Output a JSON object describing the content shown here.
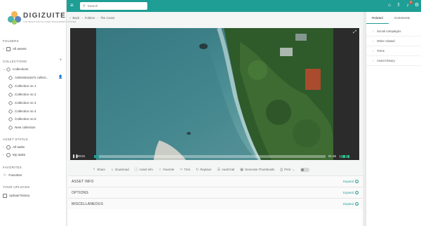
{
  "brand": {
    "name": "DIGIZUITE",
    "tagline": "THE SMART DIGITAL ASSET MANAGEMENT SYSTEM"
  },
  "sidebar": {
    "folders_title": "FOLDERS",
    "all_assets": "All assets",
    "collections_title": "COLLECTIONS",
    "collections_root": "Collections",
    "collections": [
      "Administrator's collect...",
      "Collection no 1",
      "Collection no 2",
      "Collection no 3",
      "Collection no 4",
      "Collection no 5",
      "New collection"
    ],
    "asset_status_title": "ASSET STATUS",
    "all_tasks": "All tasks",
    "my_tasks": "My tasks",
    "favorites_title": "FAVORITES",
    "favorites": "Favorites",
    "uploads_title": "YOUR UPLOADS",
    "upload_history": "Upload history"
  },
  "topbar": {
    "search_placeholder": "Search",
    "notification_count": "3",
    "icons": [
      "menu-icon",
      "home-icon",
      "upload-icon",
      "bell-icon",
      "gear-icon"
    ]
  },
  "breadcrumb": [
    "Back",
    "Folders",
    "The Coast"
  ],
  "player": {
    "current_time": "00:04",
    "duration": "01:26",
    "progress_fraction": 0.02
  },
  "actions": [
    "Share",
    "Download",
    "Asset info",
    "Favorite",
    "Trim",
    "Replace",
    "Audit trail",
    "Generate Thumbnails",
    "Print"
  ],
  "panels": [
    {
      "title": "ASSET INFO",
      "action": "Expand"
    },
    {
      "title": "OPTIONS",
      "action": "Expand"
    },
    {
      "title": "MISCELLANEOUS",
      "action": "Expand"
    }
  ],
  "right_panel": {
    "tabs": [
      "Related",
      "Comments"
    ],
    "items": [
      "Social campaigns",
      "Other related",
      "Trims",
      "Asset History"
    ]
  },
  "colors": {
    "accent": "#1e9e95",
    "badge": "#e05340"
  }
}
